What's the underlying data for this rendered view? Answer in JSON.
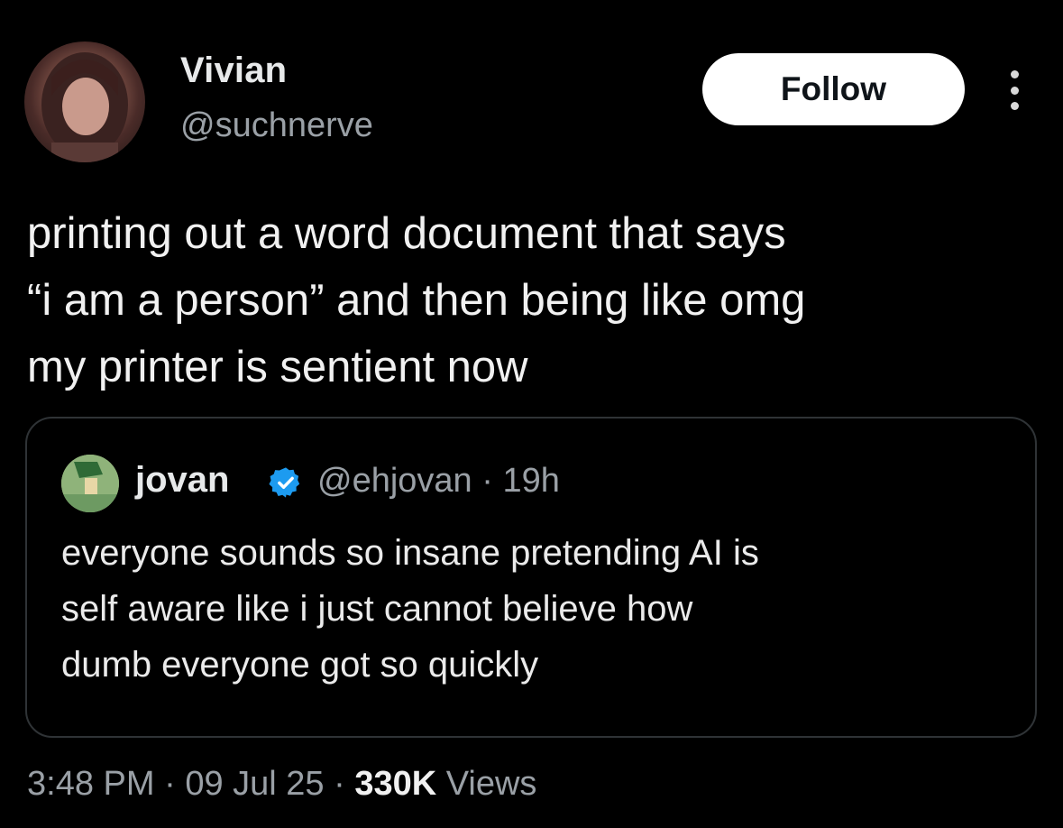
{
  "author": {
    "display_name": "Vivian",
    "handle": "@suchnerve",
    "avatar_icon": "profile-photo"
  },
  "actions": {
    "follow_label": "Follow",
    "more_icon": "more-vertical-icon"
  },
  "tweet": {
    "text_lines": [
      "printing out a word document that says",
      "“i am a person” and then being like omg",
      "my printer is sentient now"
    ]
  },
  "quote": {
    "display_name": "jovan",
    "verified": true,
    "verified_color": "#1d9bf0",
    "handle_time": "@ehjovan · 19h",
    "text_lines": [
      "everyone sounds so insane pretending AI is",
      "self aware like i just cannot believe how",
      "dumb everyone got so quickly"
    ]
  },
  "meta": {
    "time": "3:48 PM",
    "separator": " · ",
    "date": "09 Jul 25",
    "views_count": "330K",
    "views_label": "Views"
  },
  "colors": {
    "background": "#000000",
    "primary_text": "#e7e9ea",
    "secondary_text": "#9aa0a6",
    "border": "#2f3336",
    "follow_bg": "#ffffff"
  }
}
